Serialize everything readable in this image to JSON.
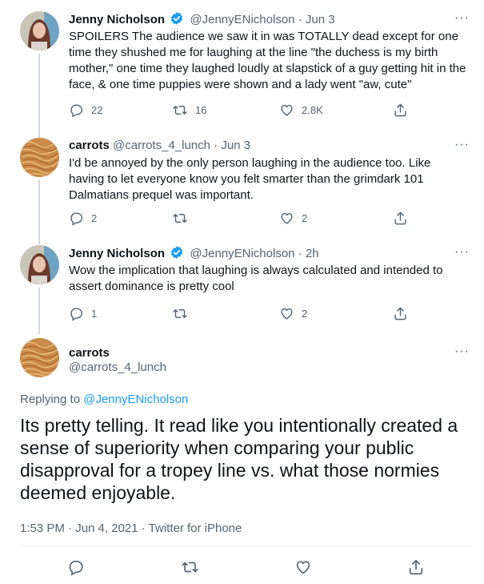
{
  "tweets": [
    {
      "name": "Jenny Nicholson",
      "handle": "@JennyENicholson",
      "time": "· Jun 3",
      "text": "SPOILERS The audience we saw it in was TOTALLY dead except for one time they shushed me for laughing at the line \"the duchess is my birth mother,\" one time they laughed loudly at slapstick of a guy getting hit in the face, & one time puppies were shown and a lady went \"aw, cute\"",
      "replies": "22",
      "retweets": "16",
      "likes": "2.8K"
    },
    {
      "name": "carrots",
      "handle": "@carrots_4_lunch",
      "time": "· Jun 3",
      "text": "I'd be annoyed by the only person laughing in the audience too. Like having to let everyone know you felt smarter than the grimdark 101 Dalmatians prequel was important.",
      "replies": "2",
      "retweets": "",
      "likes": "2"
    },
    {
      "name": "Jenny Nicholson",
      "handle": "@JennyENicholson",
      "time": "· 2h",
      "text": "Wow the implication that laughing is always calculated and intended to assert dominance is pretty cool",
      "replies": "1",
      "retweets": "",
      "likes": "2"
    }
  ],
  "focused": {
    "name": "carrots",
    "handle": "@carrots_4_lunch",
    "replying_prefix": "Replying to ",
    "replying_to": "@JennyENicholson",
    "text": "Its pretty telling. It read like you intentionally created a sense of superiority when comparing your public disapproval for a tropey line vs. what those normies deemed enjoyable.",
    "meta": "1:53 PM · Jun 4, 2021 · Twitter for iPhone"
  },
  "more_label": "···",
  "colors": {
    "text": "#0f1419",
    "secondary": "#536471",
    "accent": "#1d9bf0",
    "line": "#cfd9de"
  },
  "icons": [
    "verified-badge-icon",
    "reply-icon",
    "retweet-icon",
    "like-icon",
    "share-icon",
    "more-icon"
  ]
}
